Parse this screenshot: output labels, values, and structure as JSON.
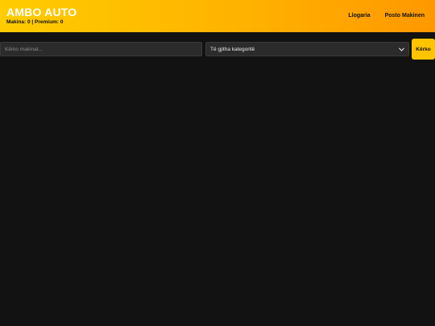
{
  "header": {
    "title": "AMBO AUTO",
    "stats": "Makina: 0 | Premium: 0",
    "nav": [
      {
        "label": "Llogaria"
      },
      {
        "label": "Posto Makinen"
      }
    ],
    "colors": {
      "gradient_start": "#ffcc00",
      "gradient_end": "#ff9800"
    }
  },
  "search": {
    "placeholder": "Kërko makinat...",
    "value": "",
    "category_selected": "Të gjitha kategoritë",
    "button_label": "Kërko",
    "button_color": "#ffc400"
  }
}
